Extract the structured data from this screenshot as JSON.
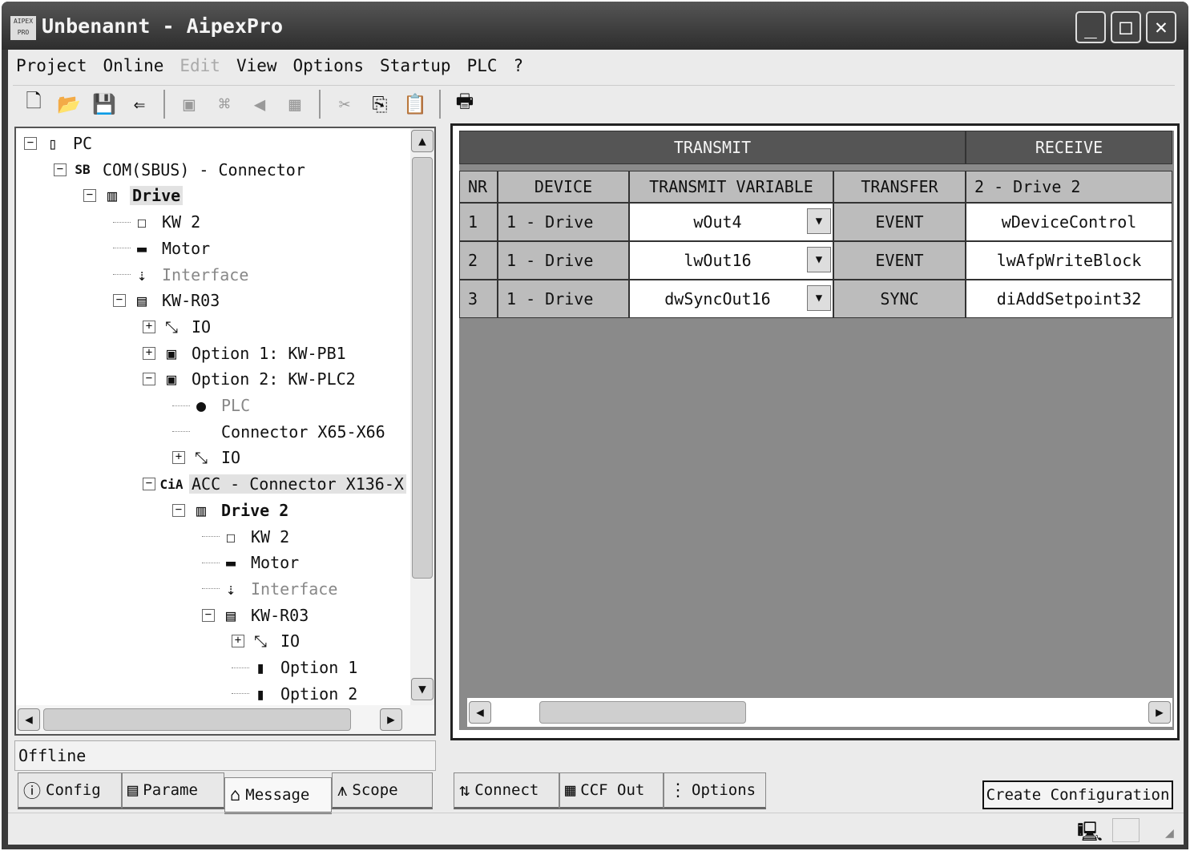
{
  "window": {
    "title": "Unbenannt - AipexPro",
    "app_icon": "AIPEX PRO",
    "minimize": "_",
    "maximize": "□",
    "close": "✕"
  },
  "menu": [
    "Project",
    "Online",
    "Edit",
    "View",
    "Options",
    "Startup",
    "PLC",
    "?"
  ],
  "toolbar": [
    "new-icon",
    "open-icon",
    "save-icon",
    "import-icon",
    "sep",
    "device-icon",
    "network-icon",
    "back-icon",
    "calculator-icon",
    "sep",
    "cut-icon",
    "copy-icon",
    "paste-icon",
    "sep",
    "print-icon"
  ],
  "tree": [
    {
      "label": "PC",
      "level": 0,
      "exp": "−",
      "icon": "▯"
    },
    {
      "label": "COM(SBUS) - Connector",
      "level": 1,
      "exp": "−",
      "icon": "SB"
    },
    {
      "label": "Drive",
      "level": 2,
      "exp": "−",
      "icon": "▥",
      "bold": true,
      "hl": true
    },
    {
      "label": "KW 2",
      "level": 3,
      "icon": "☐"
    },
    {
      "label": "Motor",
      "level": 3,
      "icon": "▬"
    },
    {
      "label": "Interface",
      "level": 3,
      "icon": "⇣",
      "gray": true
    },
    {
      "label": "KW-R03",
      "level": 3,
      "exp": "−",
      "icon": "▤"
    },
    {
      "label": "IO",
      "level": 4,
      "exp": "+",
      "icon": "⤡"
    },
    {
      "label": "Option 1: KW-PB1",
      "level": 4,
      "exp": "+",
      "icon": "▣"
    },
    {
      "label": "Option 2: KW-PLC2",
      "level": 4,
      "exp": "−",
      "icon": "▣"
    },
    {
      "label": "PLC",
      "level": 5,
      "icon": "●",
      "gray": true
    },
    {
      "label": "Connector X65-X66",
      "level": 5,
      "icon": ""
    },
    {
      "label": "IO",
      "level": 5,
      "exp": "+",
      "icon": "⤡"
    },
    {
      "label": "ACC - Connector X136-X",
      "level": 4,
      "exp": "−",
      "icon": "CiA",
      "hl": true
    },
    {
      "label": "Drive 2",
      "level": 5,
      "exp": "−",
      "icon": "▥",
      "bold": true
    },
    {
      "label": "KW 2",
      "level": 6,
      "icon": "☐"
    },
    {
      "label": "Motor",
      "level": 6,
      "icon": "▬"
    },
    {
      "label": "Interface",
      "level": 6,
      "icon": "⇣",
      "gray": true
    },
    {
      "label": "KW-R03",
      "level": 6,
      "exp": "−",
      "icon": "▤"
    },
    {
      "label": "IO",
      "level": 7,
      "exp": "+",
      "icon": "⤡"
    },
    {
      "label": "Option 1",
      "level": 7,
      "icon": "▮"
    },
    {
      "label": "Option 2",
      "level": 7,
      "icon": "▮"
    }
  ],
  "status": "Offline",
  "left_tabs": [
    {
      "label": "Config",
      "icon": "ⓘ"
    },
    {
      "label": "Parame",
      "icon": "▤"
    },
    {
      "label": "Message",
      "icon": "⌂",
      "selected": true
    },
    {
      "label": "Scope",
      "icon": "⩚"
    }
  ],
  "table": {
    "group_headers": [
      "TRANSMIT",
      "RECEIVE"
    ],
    "headers": [
      "NR",
      "DEVICE",
      "TRANSMIT VARIABLE",
      "TRANSFER",
      "2 - Drive 2"
    ],
    "rows": [
      [
        "1",
        "1 - Drive",
        "wOut4",
        "EVENT",
        "wDeviceControl"
      ],
      [
        "2",
        "1 - Drive",
        "lwOut16",
        "EVENT",
        "lwAfpWriteBlock"
      ],
      [
        "3",
        "1 - Drive",
        "dwSyncOut16",
        "SYNC",
        "diAddSetpoint32"
      ]
    ]
  },
  "right_tabs": [
    {
      "label": "Connect",
      "icon": "⇅"
    },
    {
      "label": "CCF Out",
      "icon": "▦"
    },
    {
      "label": "Options",
      "icon": "⋮"
    }
  ],
  "create_button": "Create Configuration"
}
